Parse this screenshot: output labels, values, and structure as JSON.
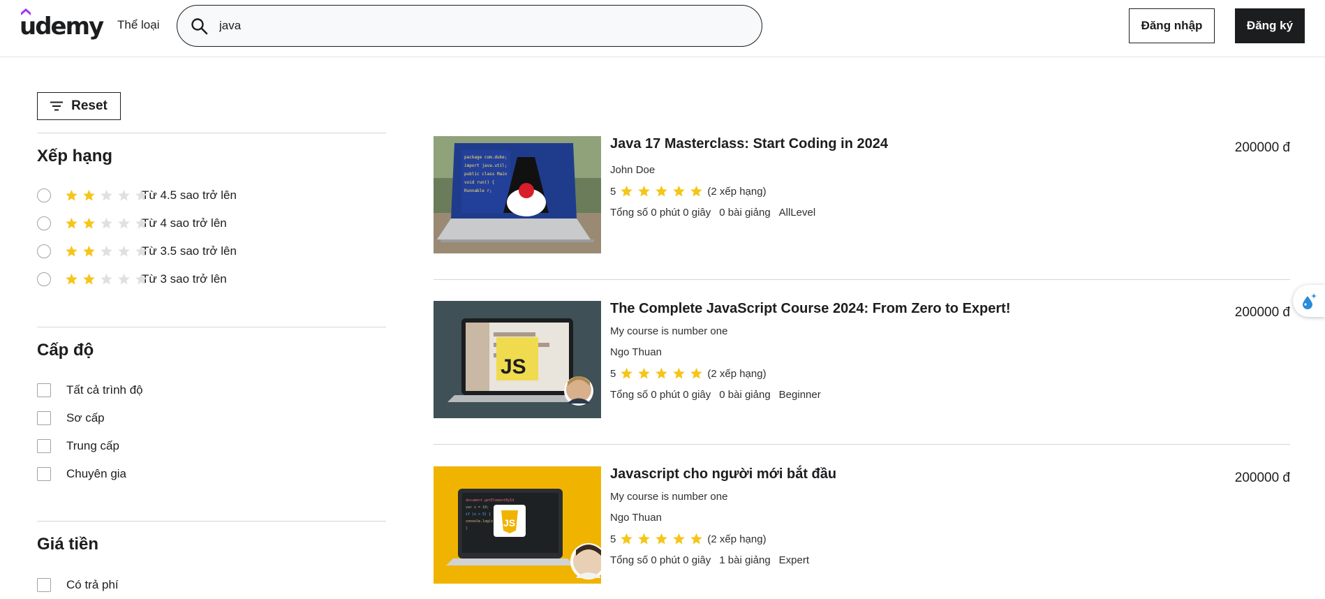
{
  "header": {
    "logo_text": "udemy",
    "categories_label": "Thể loại",
    "search_value": "java",
    "login_label": "Đăng nhập",
    "signup_label": "Đăng ký"
  },
  "sidebar": {
    "reset_label": "Reset",
    "rating_title": "Xếp hạng",
    "rating_options": [
      {
        "label": "Từ 4.5 sao trở lên",
        "stars_filled": 2
      },
      {
        "label": "Từ 4 sao trở lên",
        "stars_filled": 2
      },
      {
        "label": "Từ 3.5 sao trở lên",
        "stars_filled": 2
      },
      {
        "label": "Từ 3 sao trở lên",
        "stars_filled": 2
      }
    ],
    "level_title": "Cấp độ",
    "level_options": [
      "Tất cả trình độ",
      "Sơ cấp",
      "Trung cấp",
      "Chuyên gia"
    ],
    "price_title": "Giá tiền",
    "price_options": [
      "Có trả phí"
    ]
  },
  "courses": [
    {
      "title": "Java 17 Masterclass: Start Coding in 2024",
      "subtitle": "",
      "instructor": "John Doe",
      "rating": "5",
      "rating_count": "(2 xếp hạng)",
      "duration": "Tổng số 0 phút 0 giây",
      "lectures": "0 bài giảng",
      "level": "AllLevel",
      "price": "200000 đ"
    },
    {
      "title": "The Complete JavaScript Course 2024: From Zero to Expert!",
      "subtitle": "My course is number one",
      "instructor": "Ngo Thuan",
      "rating": "5",
      "rating_count": "(2 xếp hạng)",
      "duration": "Tổng số 0 phút 0 giây",
      "lectures": "0 bài giảng",
      "level": "Beginner",
      "price": "200000 đ",
      "thumb_text": "JS"
    },
    {
      "title": "Javascript cho người mới bắt đầu",
      "subtitle": "My course is number one",
      "instructor": "Ngo Thuan",
      "rating": "5",
      "rating_count": "(2 xếp hạng)",
      "duration": "Tổng số 0 phút 0 giây",
      "lectures": "1 bài giảng",
      "level": "Expert",
      "price": "200000 đ",
      "thumb_text": "JS"
    }
  ],
  "colors": {
    "star": "#f5c518",
    "star_empty": "#e0e0e0",
    "dark": "#1c1d1f",
    "brand": "#a435f0"
  }
}
